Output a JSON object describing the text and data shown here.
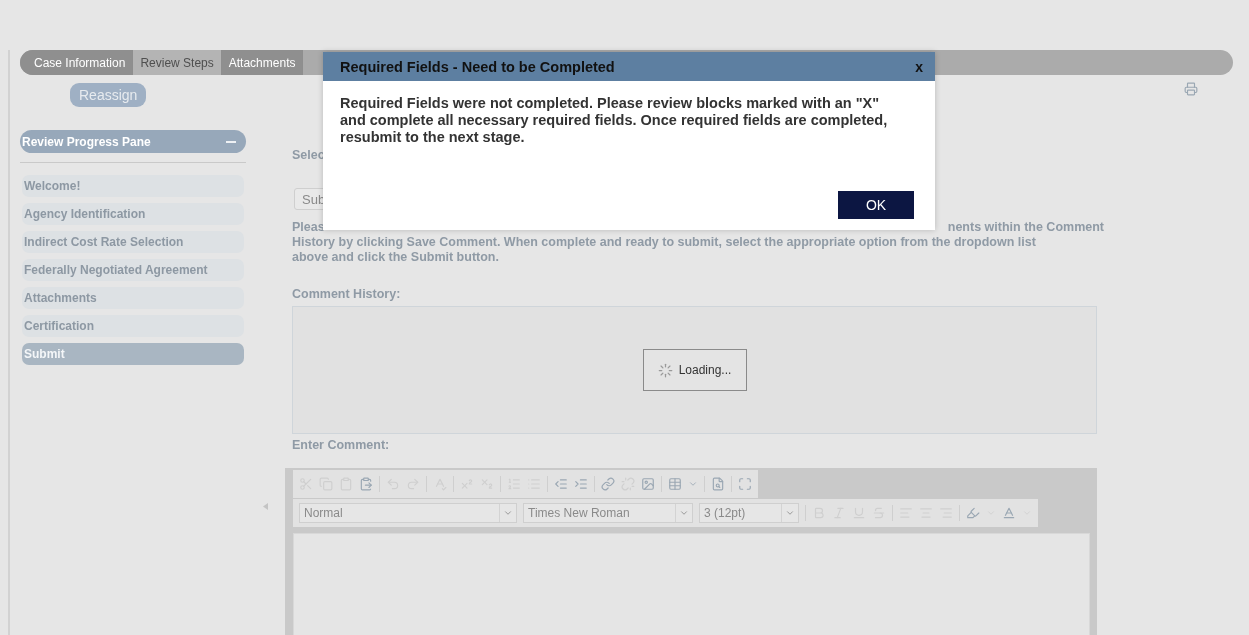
{
  "tabs": [
    {
      "label": "Case Information",
      "selected": false
    },
    {
      "label": "Review Steps",
      "selected": true
    },
    {
      "label": "Attachments",
      "selected": false
    }
  ],
  "reassign_button": "Reassign",
  "progress_pane": {
    "title": "Review Progress Pane",
    "expanded": true,
    "items": [
      {
        "label": "Welcome!",
        "selected": false
      },
      {
        "label": "Agency Identification",
        "selected": false
      },
      {
        "label": "Indirect Cost Rate Selection",
        "selected": false
      },
      {
        "label": "Federally Negotiated Agreement",
        "selected": false
      },
      {
        "label": "Attachments",
        "selected": false
      },
      {
        "label": "Certification",
        "selected": false
      },
      {
        "label": "Submit",
        "selected": true
      }
    ]
  },
  "main": {
    "select_label": "Selec",
    "dropdown_value": "Sub",
    "instructions": {
      "line_1_start": "Pleas",
      "line_1_end": "nents within the Comment",
      "line_2": "History by clicking Save Comment. When complete and ready to submit, select the appropriate option from the dropdown list",
      "line_3": "above and click the Submit button."
    },
    "comment_history_label": "Comment History:",
    "loading_text": "Loading...",
    "enter_comment_label": "Enter Comment:",
    "editor": {
      "format": "Normal",
      "font": "Times New Roman",
      "size": "3 (12pt)"
    }
  },
  "dialog": {
    "title": "Required Fields - Need to be Completed",
    "close": "x",
    "message": "Required Fields were not completed. Please review blocks marked with an \"X\" and complete all necessary required fields. Once required fields are completed, resubmit to the next stage.",
    "ok_button": "OK"
  }
}
